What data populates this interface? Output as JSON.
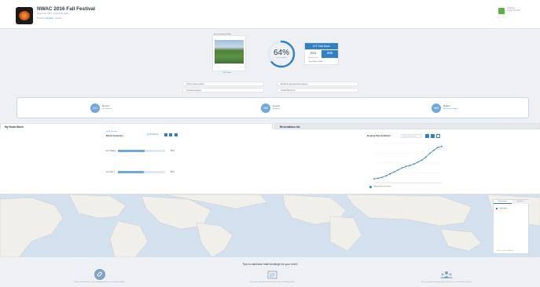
{
  "header": {
    "title": "NWAC 2016 Fall Festival",
    "dates": "August 20, 2016 - August 28, 2016",
    "manager_prefix": "Inventory",
    "manager_link": "Uploaded",
    "manager_suffix": "- Vendors",
    "published_label": "Published",
    "published_date": "August 20, 2016"
  },
  "summary": {
    "photo_title": "Event Summary Photo",
    "photo_button": "Edit Photo",
    "percent": "64%",
    "percent_label": "rooms booked",
    "percent_value": 0.64,
    "total_label": "672 Total Block",
    "available_value": "221",
    "picked_value": "385",
    "available_label": "Available Rooms",
    "picked_label": "Picked-up Rooms",
    "view_button": "View Block & Rates"
  },
  "links": [
    {
      "label": "Visitor's Reservations"
    },
    {
      "label": "Email Me Selected Reservations"
    },
    {
      "label": "Find Reservations"
    },
    {
      "label": "Upload Block List"
    }
  ],
  "stats": [
    {
      "value": "211",
      "label": "Rooms",
      "sub": "Reservations"
    },
    {
      "value": "382",
      "label": "Guests",
      "sub": "Attendees"
    },
    {
      "value": "389",
      "label": "Nights",
      "sub": "Reservation Nights"
    }
  ],
  "tabs": {
    "block": "My Room Block",
    "reservations": "Reservations list"
  },
  "block": {
    "heading": "Block Summary",
    "subheading": "Hotel Inventory",
    "print_label": "Print Block",
    "rows": [
      {
        "label": "For Singles",
        "value": "56%",
        "fraction": 0.56
      },
      {
        "label": "Ave Nite 1",
        "value": "55%",
        "fraction": 0.55
      }
    ]
  },
  "chart_data": {
    "type": "line",
    "title": "Booking Pace & Method",
    "xlabel": "",
    "ylabel": "",
    "ylim": [
      0,
      400
    ],
    "series": [
      {
        "name": "Online (Link for Passkey)",
        "values": [
          40,
          45,
          55,
          70,
          90,
          110,
          130,
          150,
          165,
          175,
          190,
          210,
          230,
          260,
          300,
          330,
          360,
          370
        ]
      }
    ],
    "legend": "bottom-left"
  },
  "chart_controls": {
    "dropdown": "Reservation Count"
  },
  "map": {
    "tab_reservations": "Reservations",
    "tab_other": "Attendees",
    "legend_item": "For Singles",
    "footer": "Show Location of Attendee"
  },
  "tips": {
    "heading": "Tips to maximize hotel bookings for your event",
    "items": [
      {
        "icon": "link-icon",
        "text": "Share the link for your event's booking website on your event website."
      },
      {
        "icon": "newsletter-icon",
        "text": "Email your attendees the link to your event's booking website."
      },
      {
        "icon": "group-icon",
        "text": "Post your event's booking website link on your social media channels."
      }
    ]
  },
  "colors": {
    "accent": "#2f80c4",
    "light_accent": "#6ea8dc",
    "published": "#5bb147"
  }
}
